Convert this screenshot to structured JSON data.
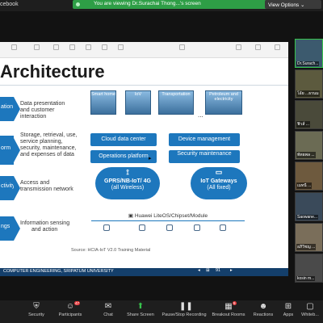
{
  "topbar": {
    "left_text": "cebook",
    "share_banner": "You are viewing Dr.Surachai Thong...'s screen",
    "view_options": "View Options"
  },
  "slide": {
    "title": "Architecture",
    "layers": [
      {
        "label": "ation",
        "desc": [
          "Data presentation",
          "and customer",
          "interaction"
        ]
      },
      {
        "label": "orm",
        "desc": [
          "Storage, retrieval, use,",
          "service planning,",
          "security, maintenance,",
          "and expenses of data"
        ]
      },
      {
        "label": "ctivity",
        "desc": [
          "Access and",
          "transmission network"
        ]
      },
      {
        "label": "ngs",
        "desc": [
          "Information sensing",
          "and action"
        ]
      }
    ],
    "apps": [
      "Smart home",
      "IoV",
      "Transportation",
      "Petroleum and electricity"
    ],
    "app_dots": "...",
    "services": [
      "Cloud data center",
      "Device management",
      "Operations platform",
      "Security maintenance"
    ],
    "clouds": [
      {
        "line1": "GPRS/NB-IoT/ 4G",
        "line2": "(all Wireless)"
      },
      {
        "line1": "IoT Gateways",
        "line2": "(All fixed)"
      }
    ],
    "chip_bar": "Huawei LiteOS/Chipset/Module",
    "source": "Source: HCIA-IoT V2.0 Training Material",
    "footer": "COMPUTER ENGINEERING, SRIPATUM UNIVERSITY",
    "page_number": "91"
  },
  "gallery": [
    {
      "name": "Dr.Surach..."
    },
    {
      "name": "โอ้ย ...ธรนม"
    },
    {
      "name": "ฟิวส์ ..."
    },
    {
      "name": "พัทธพล ..."
    },
    {
      "name": "เมทนี ..."
    },
    {
      "name": "Saowane..."
    },
    {
      "name": "อภิวิชญ ..."
    },
    {
      "name": "kosin m..."
    }
  ],
  "bottombar": {
    "items": [
      {
        "label": "Security"
      },
      {
        "label": "Participants",
        "badge": "47"
      },
      {
        "label": "Chat"
      },
      {
        "label": "Share Screen"
      },
      {
        "label": "Pause/Stop Recording"
      },
      {
        "label": "Breakout Rooms",
        "badge": "5"
      },
      {
        "label": "Reactions"
      },
      {
        "label": "Apps"
      },
      {
        "label": "Whiteb..."
      }
    ]
  },
  "colors": {
    "accent": "#1d77bd",
    "share_green": "#2e9e46",
    "slide_footer": "#143f6b"
  }
}
